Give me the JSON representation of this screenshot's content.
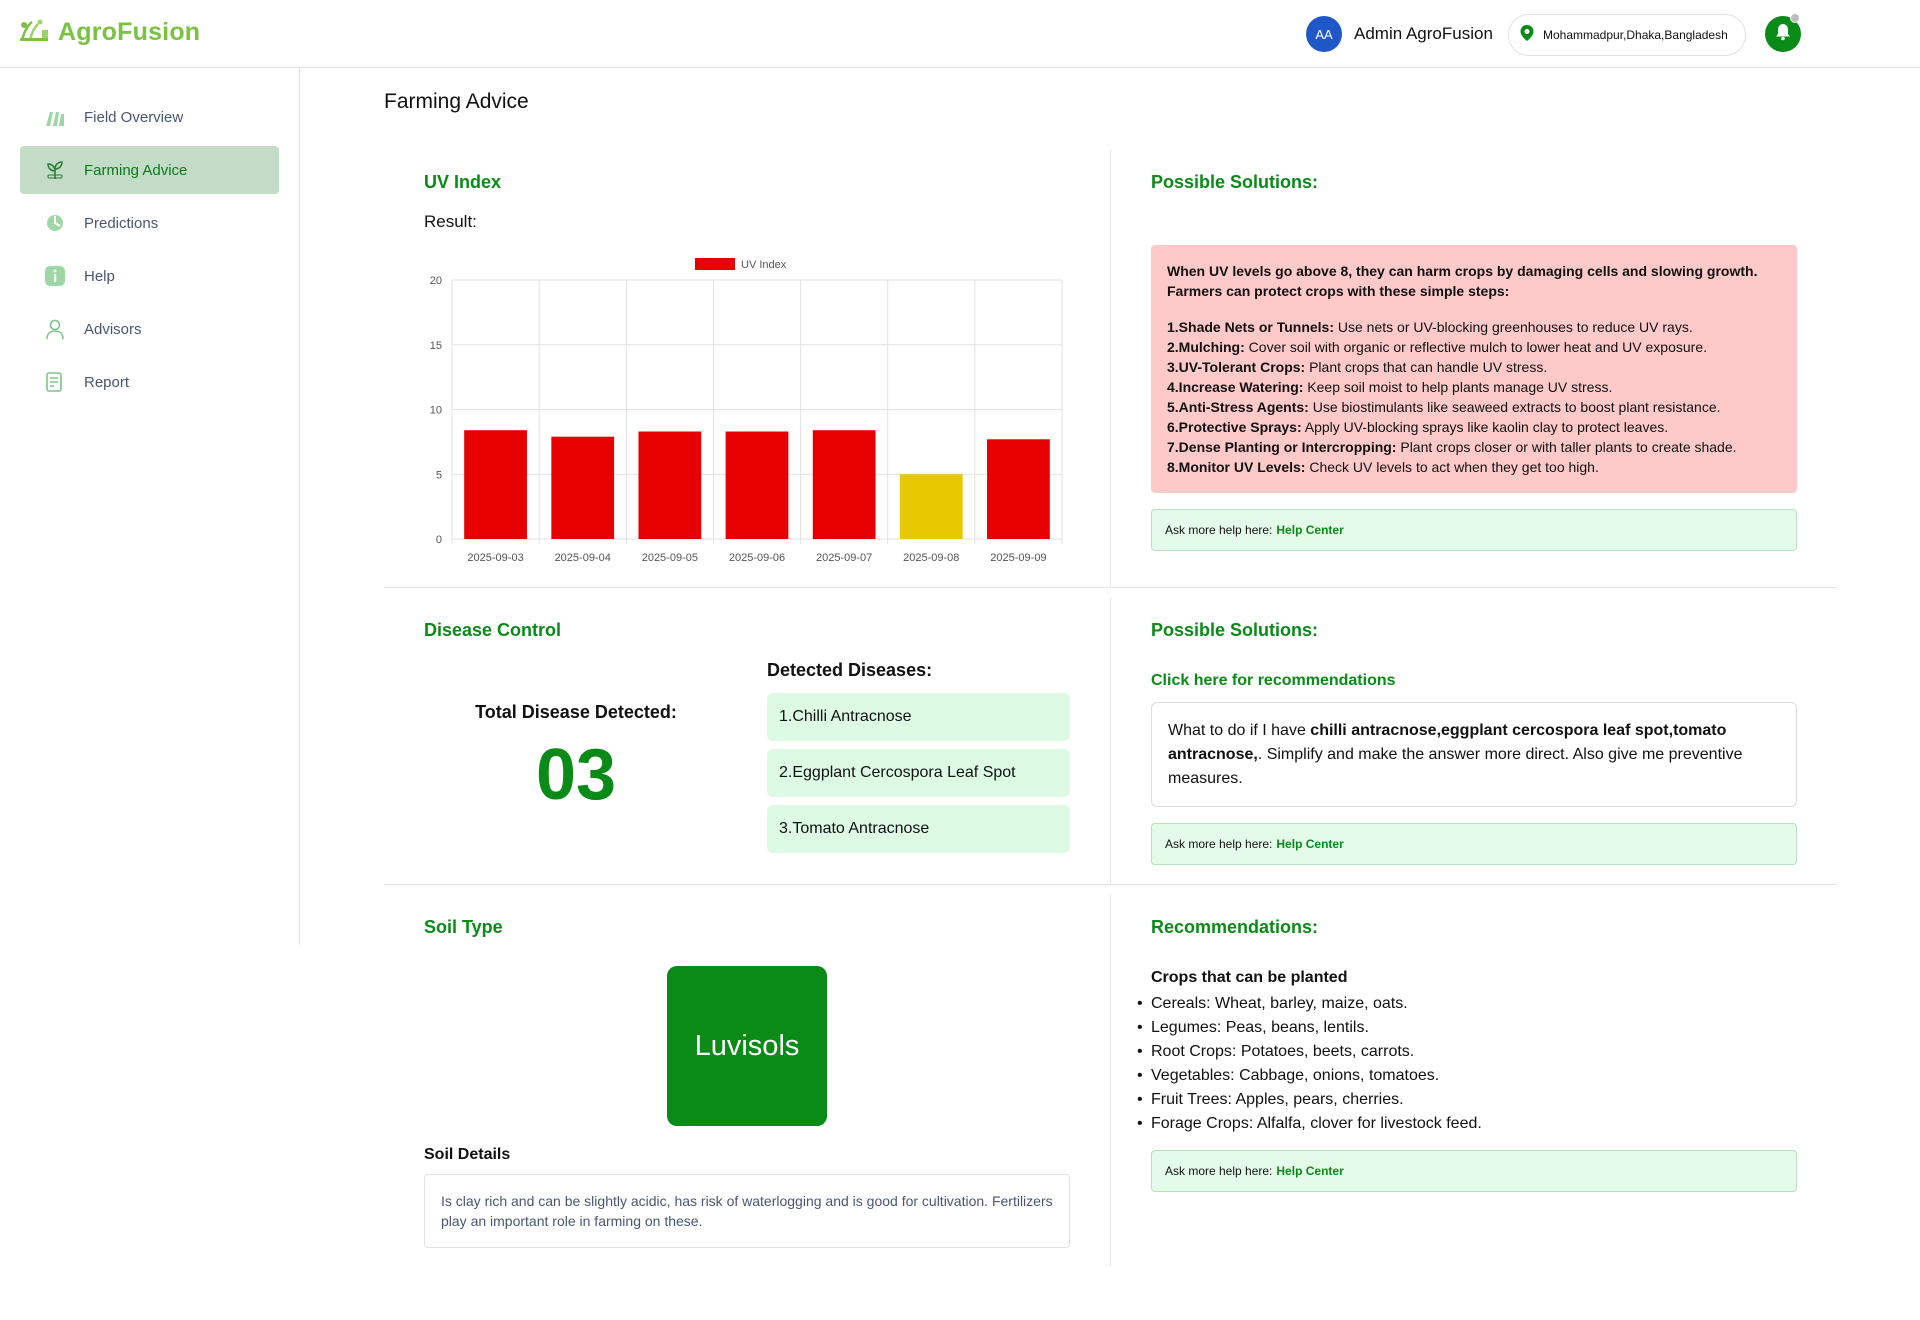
{
  "app": {
    "name": "AgroFusion"
  },
  "header": {
    "avatar_initials": "AA",
    "user_name": "Admin AgroFusion",
    "location": "Mohammadpur,Dhaka,Bangladesh"
  },
  "sidebar": {
    "items": [
      {
        "label": "Field Overview",
        "icon": "field-icon",
        "active": false
      },
      {
        "label": "Farming Advice",
        "icon": "plant-icon",
        "active": true
      },
      {
        "label": "Predictions",
        "icon": "predictions-icon",
        "active": false
      },
      {
        "label": "Help",
        "icon": "info-icon",
        "active": false
      },
      {
        "label": "Advisors",
        "icon": "advisor-icon",
        "active": false
      },
      {
        "label": "Report",
        "icon": "report-icon",
        "active": false
      }
    ]
  },
  "page": {
    "title": "Farming Advice"
  },
  "uv": {
    "title": "UV Index",
    "result_label": "Result:",
    "solutions_title": "Possible Solutions:",
    "solutions_intro": "When UV levels go above 8, they can harm crops by damaging cells and slowing growth. Farmers can protect crops with these simple steps:",
    "solutions": [
      {
        "bold": "1.Shade Nets or Tunnels:",
        "text": " Use nets or UV-blocking greenhouses to reduce UV rays."
      },
      {
        "bold": "2.Mulching:",
        "text": " Cover soil with organic or reflective mulch to lower heat and UV exposure."
      },
      {
        "bold": "3.UV-Tolerant Crops:",
        "text": " Plant crops that can handle UV stress."
      },
      {
        "bold": "4.Increase Watering:",
        "text": " Keep soil moist to help plants manage UV stress."
      },
      {
        "bold": "5.Anti-Stress Agents:",
        "text": " Use biostimulants like seaweed extracts to boost plant resistance."
      },
      {
        "bold": "6.Protective Sprays:",
        "text": " Apply UV-blocking sprays like kaolin clay to protect leaves."
      },
      {
        "bold": "7.Dense Planting or Intercropping:",
        "text": " Plant crops closer or with taller plants to create shade."
      },
      {
        "bold": "8.Monitor UV Levels:",
        "text": " Check UV levels to act when they get too high."
      }
    ]
  },
  "help": {
    "prefix": "Ask more help here:",
    "link": "Help Center"
  },
  "disease": {
    "title": "Disease Control",
    "total_label": "Total Disease Detected:",
    "total_count": "03",
    "detected_title": "Detected Diseases:",
    "items": [
      "1.Chilli Antracnose",
      "2.Eggplant Cercospora Leaf Spot",
      "3.Tomato Antracnose"
    ],
    "solutions_title": "Possible Solutions:",
    "recommendations_link": "Click here for recommendations",
    "query_prefix": "What to do if I have ",
    "query_bold": "chilli antracnose,eggplant cercospora leaf spot,tomato antracnose,",
    "query_suffix": ". Simplify and make the answer more direct. Also give me preventive measures."
  },
  "soil": {
    "title": "Soil Type",
    "type": "Luvisols",
    "details_title": "Soil Details",
    "details": "Is clay rich and can be slightly acidic, has risk of waterlogging and is good for cultivation. Fertilizers play an important role in farming on these.",
    "recommendations_title": "Recommendations:",
    "crops_title": "Crops that can be planted",
    "crops": [
      "Cereals: Wheat, barley, maize, oats.",
      "Legumes: Peas, beans, lentils.",
      "Root Crops: Potatoes, beets, carrots.",
      "Vegetables: Cabbage, onions, tomatoes.",
      "Fruit Trees: Apples, pears, cherries.",
      "Forage Crops: Alfalfa, clover for livestock feed."
    ]
  },
  "colors": {
    "brand": "#7cc242",
    "accent": "#0a8a17",
    "uv_high": "#e60000",
    "uv_moderate": "#e8c800"
  },
  "chart_data": {
    "type": "bar",
    "categories": [
      "2025-09-03",
      "2025-09-04",
      "2025-09-05",
      "2025-09-06",
      "2025-09-07",
      "2025-09-08",
      "2025-09-09"
    ],
    "series": [
      {
        "name": "UV Index",
        "values": [
          8.4,
          7.9,
          8.3,
          8.3,
          8.4,
          5.0,
          7.7
        ]
      }
    ],
    "bar_colors": [
      "#e60000",
      "#e60000",
      "#e60000",
      "#e60000",
      "#e60000",
      "#e8c800",
      "#e60000"
    ],
    "ylim": [
      0,
      20
    ],
    "yticks": [
      0,
      5,
      10,
      15,
      20
    ],
    "grid": true,
    "legend": "top-center"
  }
}
